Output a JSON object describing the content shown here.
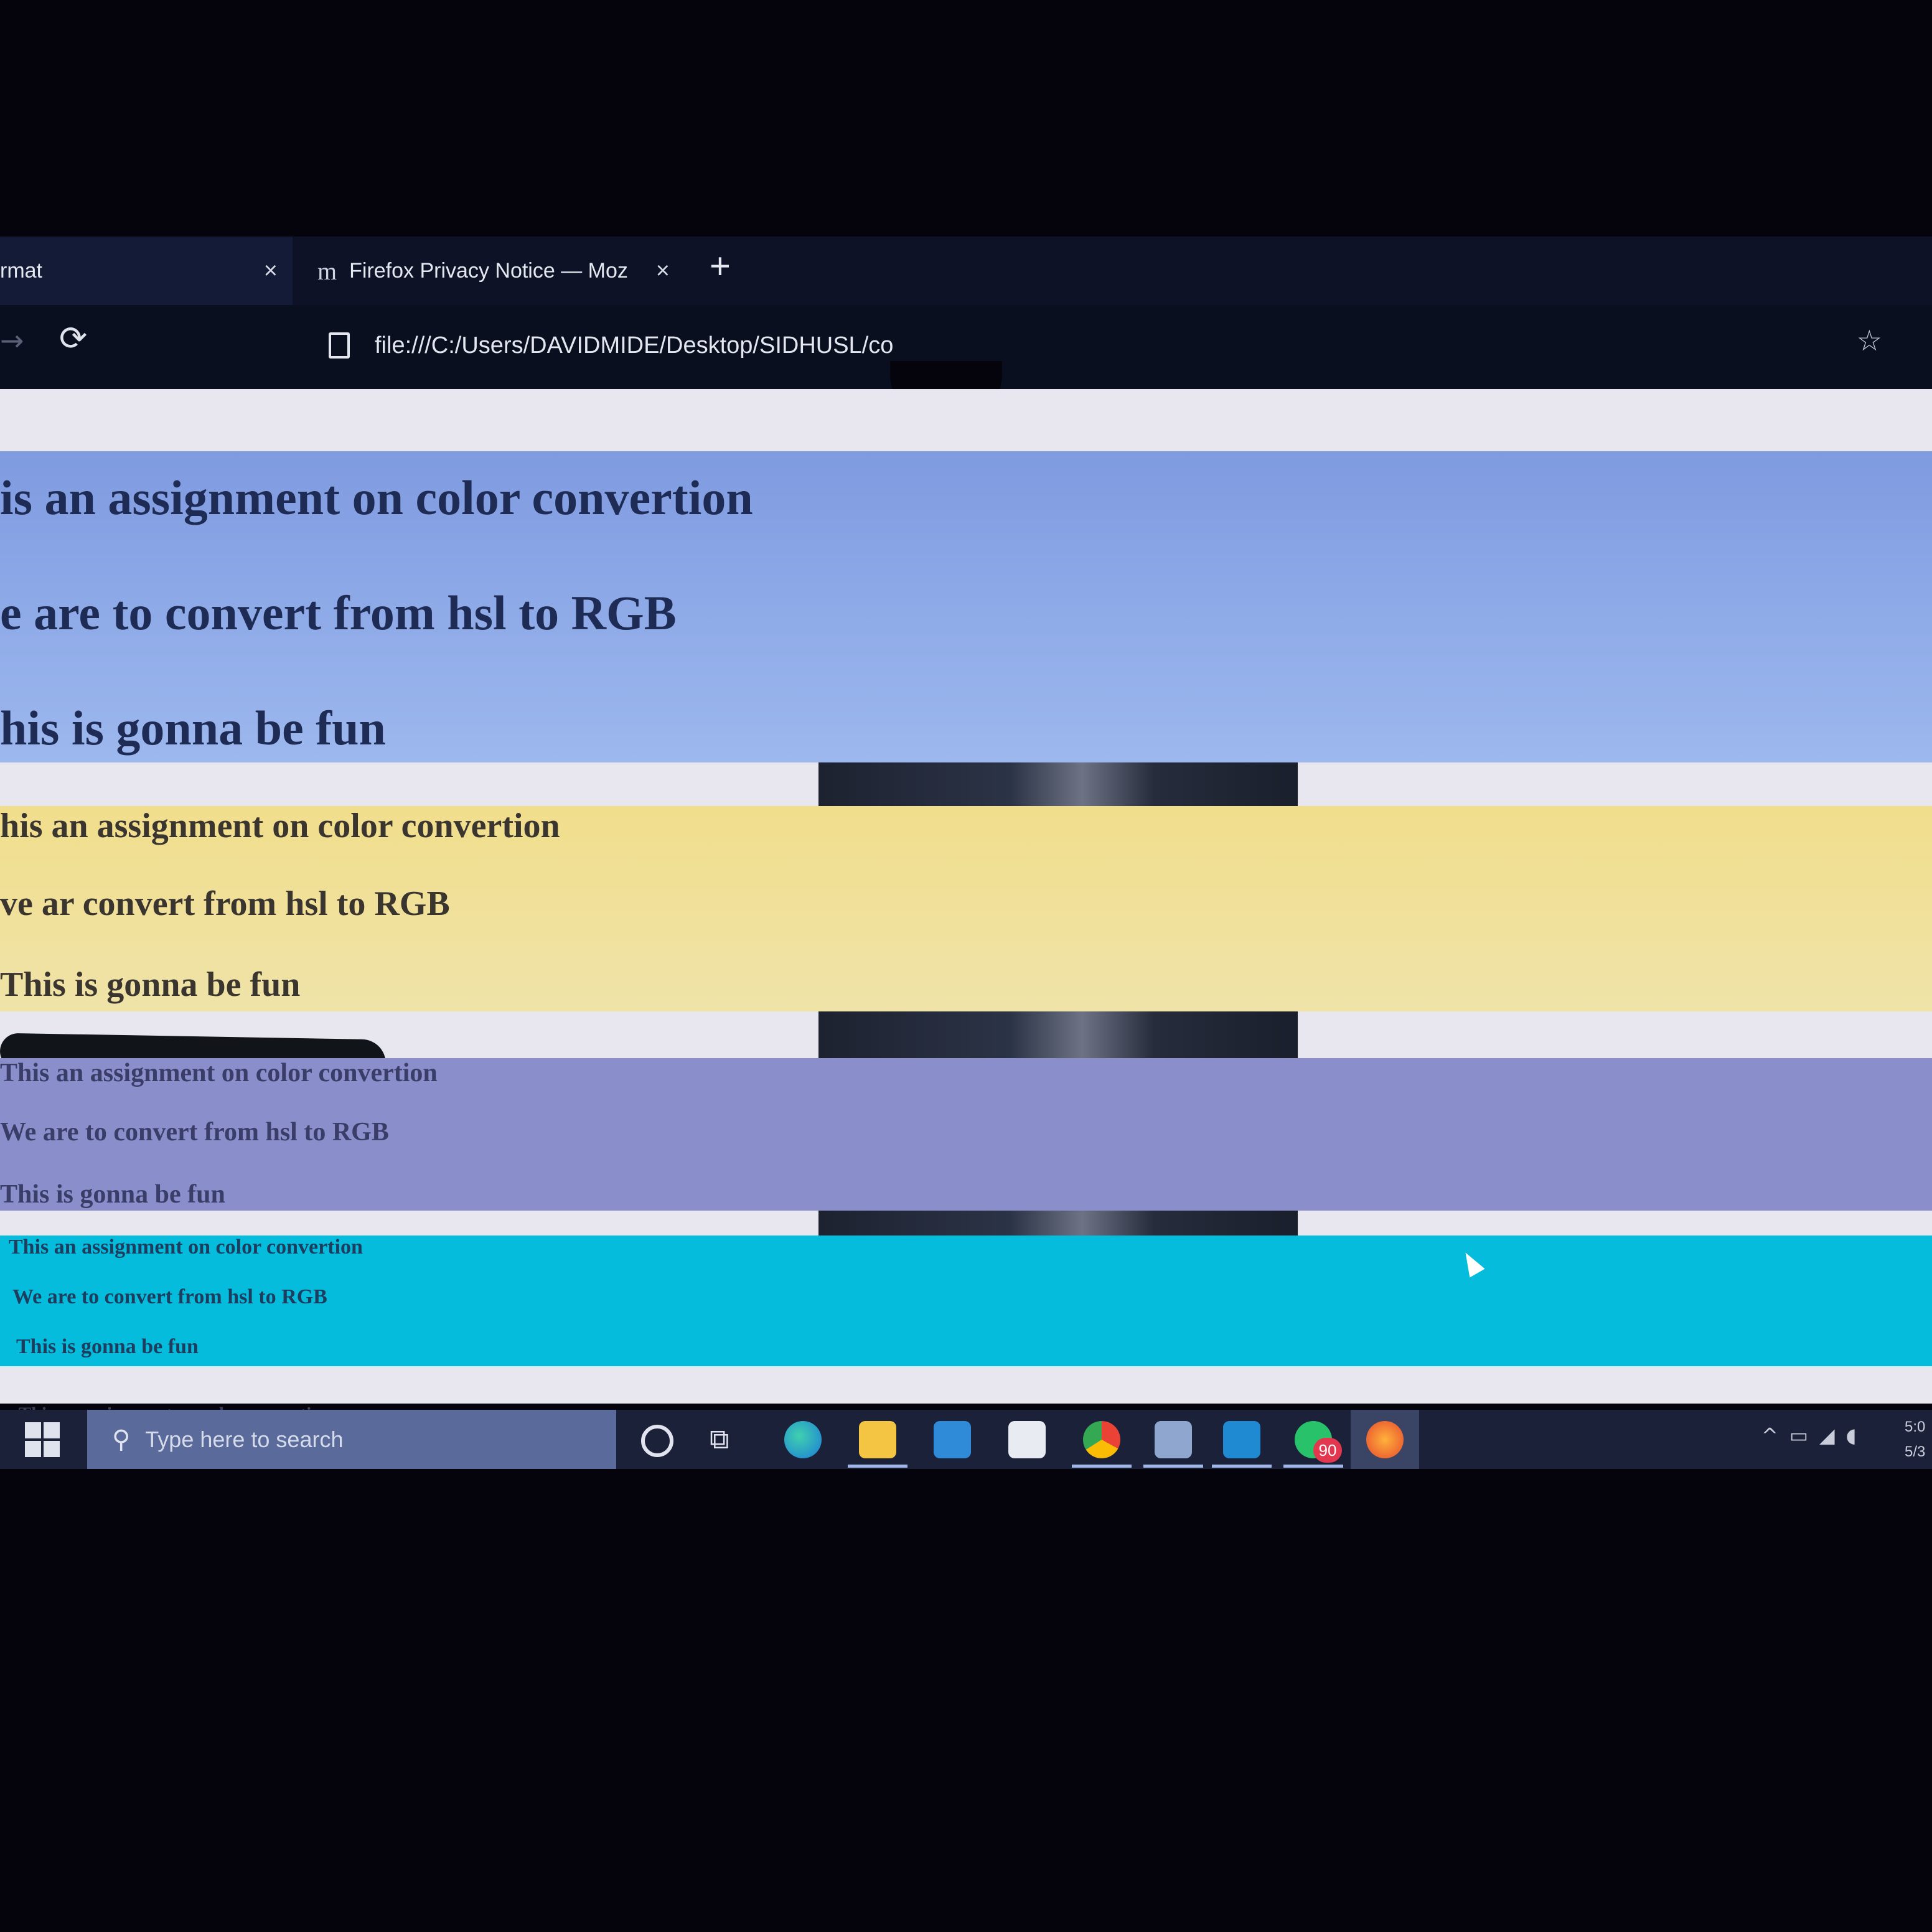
{
  "browser": {
    "tabs": [
      {
        "title": "rmat",
        "close": "×"
      },
      {
        "title": "Firefox Privacy Notice — Moz",
        "favicon": "m",
        "close": "×"
      }
    ],
    "new_tab": "+",
    "url": "file:///C:/Users/DAVIDMIDE/Desktop/SIDHUSL/co"
  },
  "page": {
    "sections": [
      {
        "color": "#8aa6e6",
        "lines": [
          "is an assignment on color convertion",
          "e are to convert from hsl to RGB",
          "his is gonna be fun"
        ]
      },
      {
        "color": "#f0df90",
        "lines": [
          "his an assignment on color convertion",
          "ve ar   convert from hsl to RGB",
          "This is gonna be fun"
        ]
      },
      {
        "color": "#8a8fcb",
        "lines": [
          "This an assignment on color convertion",
          "We are to convert from hsl to RGB",
          "This is gonna be fun"
        ]
      },
      {
        "color": "#06bcdc",
        "lines": [
          "This an assignment on color convertion",
          "We are to convert from hsl to RGB",
          "This is gonna be fun"
        ]
      }
    ],
    "trailing_line": "This an assignment on color convertion"
  },
  "taskbar": {
    "search_placeholder": "Type here to search",
    "apps": [
      "cortana-icon",
      "task-view-icon",
      "edge-icon",
      "file-explorer-icon",
      "store-icon",
      "mail-icon",
      "chrome-icon",
      "remote-desktop-icon",
      "vscode-icon",
      "whatsapp-icon",
      "firefox-icon"
    ],
    "whatsapp_badge": "90",
    "clock": [
      "5:0",
      "5/3"
    ]
  }
}
